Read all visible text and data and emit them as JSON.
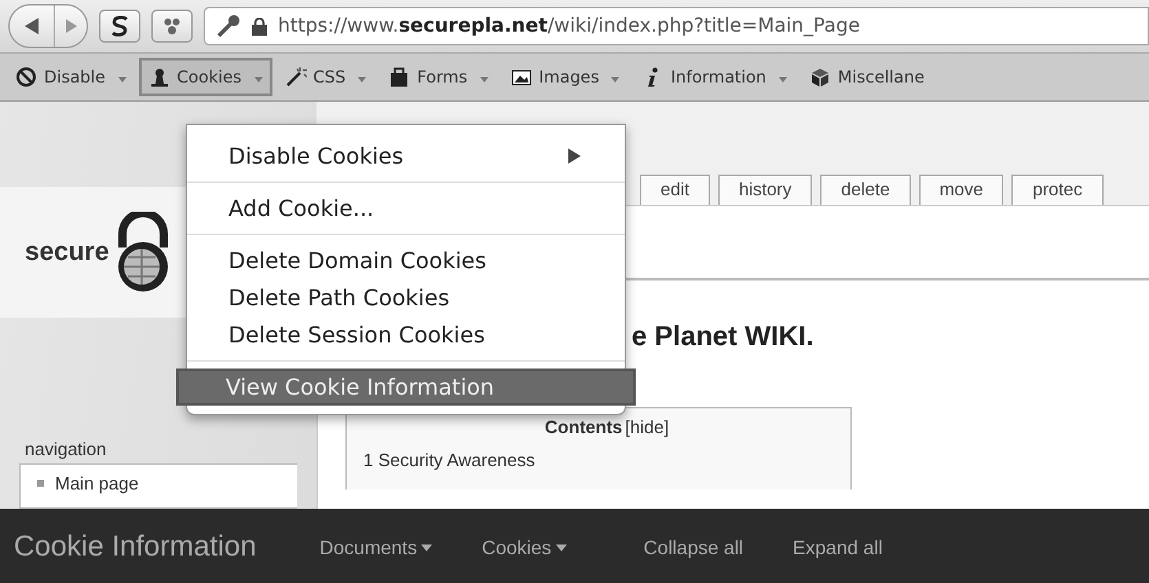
{
  "browser": {
    "url": "https://www.**securepla.net**/wiki/index.php?title=Main_Page"
  },
  "toolbar": [
    {
      "label": "Disable",
      "selected": false
    },
    {
      "label": "Cookies",
      "selected": true
    },
    {
      "label": "CSS",
      "selected": false
    },
    {
      "label": "Forms",
      "selected": false
    },
    {
      "label": "Images",
      "selected": false
    },
    {
      "label": "Information",
      "selected": false
    },
    {
      "label": "Miscellane",
      "selected": false
    }
  ],
  "menu": {
    "groups": [
      [
        {
          "label": "Disable Cookies",
          "submenu": true,
          "selected": false
        }
      ],
      [
        {
          "label": "Add Cookie...",
          "submenu": false,
          "selected": false
        }
      ],
      [
        {
          "label": "Delete Domain Cookies",
          "submenu": false,
          "selected": false
        },
        {
          "label": "Delete Path Cookies",
          "submenu": false,
          "selected": false
        },
        {
          "label": "Delete Session Cookies",
          "submenu": false,
          "selected": false
        }
      ],
      [
        {
          "label": "View Cookie Information",
          "submenu": false,
          "selected": true
        }
      ]
    ]
  },
  "wiki": {
    "logo_text": "secure",
    "tabs": [
      "edit",
      "history",
      "delete",
      "move",
      "protec"
    ],
    "heading": "e Planet WIKI.",
    "sidebar": {
      "heading": "navigation",
      "items": [
        "Main page"
      ]
    },
    "toc": {
      "title": "Contents",
      "toggle": "[hide]",
      "items": [
        "1 Security Awareness"
      ]
    }
  },
  "bottom_bar": {
    "title": "Cookie Information",
    "menus": [
      {
        "label": "Documents",
        "dropdown": true
      },
      {
        "label": "Cookies",
        "dropdown": true
      },
      {
        "label": "Collapse all",
        "dropdown": false
      },
      {
        "label": "Expand all",
        "dropdown": false
      }
    ]
  }
}
